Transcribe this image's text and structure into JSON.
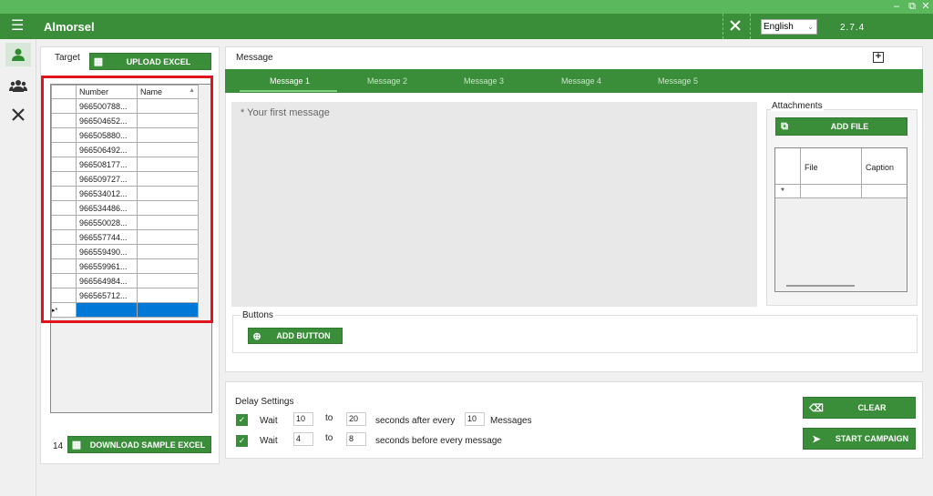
{
  "app": {
    "title": "Almorsel",
    "version": "2.7.4",
    "language": "English",
    "window_controls": {
      "minimize": "–",
      "restore": "⧉",
      "close": "✕"
    }
  },
  "target": {
    "label": "Target",
    "upload_label": "UPLOAD EXCEL",
    "columns": [
      "Number",
      "Name"
    ],
    "rows": [
      {
        "number": "966500788...",
        "name": ""
      },
      {
        "number": "966504652...",
        "name": ""
      },
      {
        "number": "966505880...",
        "name": ""
      },
      {
        "number": "966506492...",
        "name": ""
      },
      {
        "number": "966508177...",
        "name": ""
      },
      {
        "number": "966509727...",
        "name": ""
      },
      {
        "number": "966534012...",
        "name": ""
      },
      {
        "number": "966534486...",
        "name": ""
      },
      {
        "number": "966550028...",
        "name": ""
      },
      {
        "number": "966557744...",
        "name": ""
      },
      {
        "number": "966559490...",
        "name": ""
      },
      {
        "number": "966559961...",
        "name": ""
      },
      {
        "number": "966564984...",
        "name": ""
      },
      {
        "number": "966565712...",
        "name": ""
      }
    ],
    "new_row_marker": "▸*",
    "count": "14",
    "download_label": "DOWNLOAD SAMPLE EXCEL"
  },
  "message": {
    "label": "Message",
    "add_icon": "plus-square-icon",
    "tabs": [
      "Message 1",
      "Message 2",
      "Message 3",
      "Message 4",
      "Message 5"
    ],
    "placeholder": "* Your first message",
    "buttons_label": "Buttons",
    "add_button_label": "ADD BUTTON",
    "attachments_label": "Attachments",
    "add_file_label": "ADD FILE",
    "file_columns": [
      "File",
      "Caption"
    ],
    "file_new_row_marker": "*"
  },
  "delay": {
    "label": "Delay Settings",
    "row1": {
      "wait": "Wait",
      "from": "10",
      "to_label": "to",
      "to": "20",
      "text": "seconds after every",
      "count": "10",
      "suffix": "Messages"
    },
    "row2": {
      "wait": "Wait",
      "from": "4",
      "to_label": "to",
      "to": "8",
      "text": "seconds before every message"
    },
    "clear_label": "CLEAR",
    "start_label": "START CAMPAIGN"
  }
}
